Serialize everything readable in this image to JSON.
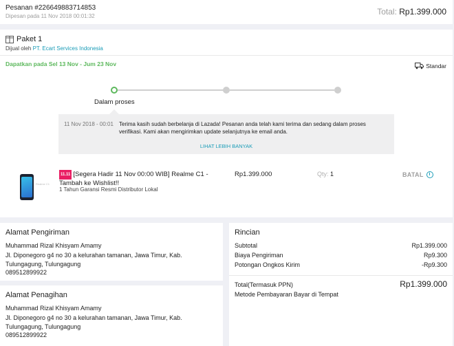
{
  "header": {
    "order_number": "Pesanan #226649883714853",
    "order_date": "Dipesan pada 11 Nov 2018 00:01:32",
    "total_label": "Total:",
    "total_value": "Rp1.399.000"
  },
  "package": {
    "title": "Paket 1",
    "icon": "package-icon",
    "seller_prefix": "Dijual oleh",
    "seller_name": "PT. Ecart Services Indonesia",
    "delivery_window": "Dapatkan pada Sel 13 Nov - Jum 23 Nov",
    "shipping_type": "Standar",
    "shipping_icon": "truck-icon",
    "tracker": {
      "step_count": 3,
      "active_step": 1,
      "active_label": "Dalam proses",
      "active_color": "#5cb85c"
    },
    "message": {
      "date": "11 Nov 2018 - 00:01",
      "text": "Terima kasih sudah berbelanja di Lazada! Pesanan anda telah kami terima dan sedang dalam proses verifikasi. Kami akan mengirimkan update selanjutnya ke email anda.",
      "more_link": "LIHAT LEBIH BANYAK"
    },
    "item": {
      "badge": "11.11",
      "name": "[Segera Hadir 11 Nov 00:00 WIB] Realme C1 - Tambah ke Wishlist!!",
      "image_tag": "Realme C1",
      "warranty": "1 Tahun Garansi Resmi Distributor Lokal",
      "price": "Rp1.399.000",
      "qty_label": "Qty:",
      "qty_value": "1",
      "status": "BATAL",
      "status_icon": "info-icon"
    }
  },
  "shipping_address": {
    "title": "Alamat Pengiriman",
    "name": "Muhammad Rizal Khisyam Amamy",
    "address": "Jl. Diponegoro g4 no 30 a kelurahan tamanan, Jawa Timur, Kab. Tulungagung, Tulungagung",
    "phone": "089512899922"
  },
  "billing_address": {
    "title": "Alamat Penagihan",
    "name": "Muhammad Rizal Khisyam Amamy",
    "address": "Jl. Diponegoro g4 no 30 a kelurahan tamanan, Jawa Timur, Kab. Tulungagung, Tulungagung",
    "phone": "089512899922"
  },
  "summary": {
    "title": "Rincian",
    "rows": [
      {
        "label": "Subtotal",
        "value": "Rp1.399.000"
      },
      {
        "label": "Biaya Pengiriman",
        "value": "Rp9.300"
      },
      {
        "label": "Potongan Ongkos Kirim",
        "value": "-Rp9.300"
      }
    ],
    "total_label": "Total(Termasuk PPN)",
    "total_value": "Rp1.399.000",
    "payment_method": "Metode Pembayaran Bayar di Tempat"
  },
  "colors": {
    "accent_green": "#5cb85c",
    "link_blue": "#1a9cb7",
    "badge_pink": "#e91e63",
    "background": "#eff0f5"
  }
}
